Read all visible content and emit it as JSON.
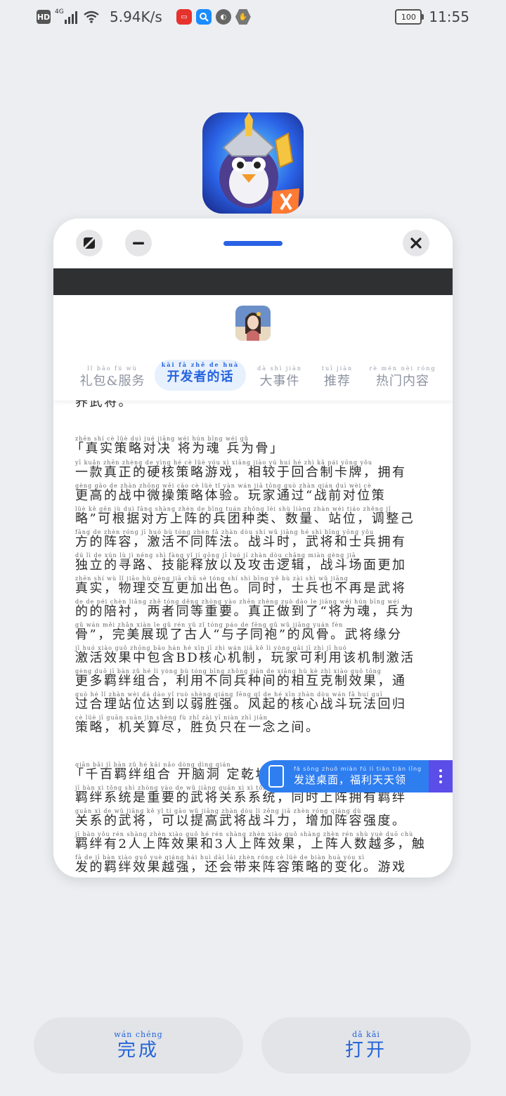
{
  "status_bar": {
    "network_badge": "HD",
    "network_type": "4G",
    "speed": "5.94K/s",
    "battery": "100",
    "time": "11:55",
    "app_icons": [
      "huawei-app-icon",
      "search-app-icon",
      "game-app-icon",
      "shield-app-icon"
    ]
  },
  "window": {
    "buttons": {
      "expand": "expand-icon",
      "minimize": "minimize-icon",
      "close": "close-icon"
    },
    "accent": "#2a62e6"
  },
  "tabs": [
    {
      "pinyin": "lǐ bāo    fú wù",
      "label": "礼包&服务"
    },
    {
      "pinyin": "kāi fā zhě de huà",
      "label": "开发者的话"
    },
    {
      "pinyin": "dà shì jiàn",
      "label": "大事件"
    },
    {
      "pinyin": "tuī jiàn",
      "label": "推荐"
    },
    {
      "pinyin": "rè mén nèi róng",
      "label": "热门内容"
    }
  ],
  "article": {
    "lines": [
      {
        "py": "",
        "text": "养武将。"
      },
      {
        "py": "zhēn  shí   cè   lüè   duì   jué       jiāng  wéi  hún     bīng  wéi   gǔ",
        "text": "「真实策略对决 将为魂 兵为骨」"
      },
      {
        "py": "yī  kuǎn zhēn zhèng de  yìng  hé   cè   lüè   yóu  xì     xiāng  jiào  yú   huí   hé   zhì   kǎ   pái      yōng  yǒu",
        "text": "一款真正的硬核策略游戏，相较于回合制卡牌，拥有"
      },
      {
        "py": "gèng  gāo  de  zhàn zhōng wēi  cāo   cè   lüè   tǐ   yàn      wán  jiā  tōng  guò    zhàn  qián  duì  wèi  cè",
        "text": "更高的战中微操策略体验。玩家通过“战前对位策"
      },
      {
        "py": "lüè      kě  gēn   jù   duì  fāng shàng zhèn de  bīng tuán zhǒng lèi     shù  liàng    zhàn  wèi     tiáo zhěng  jǐ",
        "text": "略”可根据对方上阵的兵团种类、数量、站位，调整己"
      },
      {
        "py": "fāng de zhèn róng    jī   huó   bù  tóng  zhèn  fǎ     zhàn dòu  shí     wǔ  jiāng  hé   shì  bīng yōng yǒu",
        "text": "方的阵容，激活不同阵法。战斗时，武将和士兵拥有"
      },
      {
        "py": "dú   lì   de  xún   lù     jì  néng  shì  fàng  yǐ   jí  gōng  jī   luó   jí     zhàn dòu chǎng miàn gèng  jiā",
        "text": "独立的寻路、技能释放以及攻击逻辑，战斗场面更加"
      },
      {
        "py": "zhēn  shí     wù   lǐ  jiāo  hù  gèng  jiā  chū  sè     tóng  shí     shì  bīng  yě   bù   zài  shì   wǔ  jiāng",
        "text": "真实，物理交互更加出色。同时，士兵也不再是武将"
      },
      {
        "py": "de  de  péi  chèn     liǎng  zhě tóng děng zhòng yào    zhēn zhèng  zuò  dào  le     jiāng wéi  hún      bīng  wéi",
        "text": "的的陪衬，两者同等重要。真正做到了“将为魂，兵为"
      },
      {
        "py": "gǔ      wán  měi  zhǎn xiàn  le   gǔ   rén     yǔ   zǐ  tóng  páo     de fēng  gǔ     wǔ  jiāng yuán  fèn",
        "text": "骨”，完美展现了古人“与子同袍”的风骨。武将缘分"
      },
      {
        "py": "jī   huó  xiào  guǒ zhōng bāo  hán                hé  xīn   jī   zhì     wán  jiā   kě   lì  yòng gāi  jī   zhì   jī   huó",
        "text": "激活效果中包含BD核心机制，玩家可利用该机制激活"
      },
      {
        "py": "gèng duō  jī   bàn  zǔ   hé     lì  yòng  bù  tóng bīng zhǒng jiān de  xiāng  hù   kè   zhì  xiào  guǒ     tōng",
        "text": "更多羁绊组合，利用不同兵种间的相互克制效果，通"
      },
      {
        "py": "guò  hé   lǐ  zhàn wèi  dá  dào  yǐ  ruò shèng qiáng    fēng  qǐ   de  hé  xīn  zhàn dòu  wán  fǎ   huí  guī",
        "text": "过合理站位达到以弱胜强。风起的核心战斗玩法回归"
      },
      {
        "py": "cè   lüè      jī  guān  suàn  jìn      shèng  fù   zhǐ  zài  yī  niàn  zhī  jiān",
        "text": "策略，机关算尽，胜负只在一念之间。"
      },
      {
        "py": "qiān  bǎi   jī   bàn  zǔ   hé      kāi  nǎo dòng  dìng  qián",
        "text": "「千百羁绊组合 开脑洞 定乾坤」"
      },
      {
        "py": "jī   bàn   xì  tǒng  shì zhòng yào  de  wǔ  jiāng guān  xì   xì  tǒng     tóng  shí shàng zhèn yōng  yǒu   jī   bàn",
        "text": "羁绊系统是重要的武将关系系统，同时上阵拥有羁绊"
      },
      {
        "py": "guān  xì   de  wǔ  jiāng     kě   yǐ   tí   gāo  wǔ  jiāng zhàn dòu  lì     zēng  jiā zhèn róng qiáng  dù",
        "text": "关系的武将，可以提高武将战斗力，增加阵容强度。"
      },
      {
        "py": "jī   bàn  yǒu      rén shàng zhèn xiào  guǒ  hé      rén shàng zhèn xiào  guǒ     shàng zhèn  rén  shù  yuè  duō     chù",
        "text": "羁绊有2人上阵效果和3人上阵效果，上阵人数越多，触"
      },
      {
        "py": "fā  de   jī   bàn  xiào  guǒ  yuè qiáng      hái  huì  dài  lái  zhèn róng  cè   lüè  de  biàn  huà     yóu  xì",
        "text": "发的羁绊效果越强，还会带来阵容策略的变化。游戏"
      }
    ]
  },
  "float_banner": {
    "pinyin": "fā  sòng zhuō miàn    fú   lì  tiān tiān lǐng",
    "label": "发送桌面，福利天天领"
  },
  "bottom": {
    "done": {
      "pinyin": "wán  chéng",
      "label": "完成"
    },
    "open": {
      "pinyin": "dǎ   kāi",
      "label": "打开"
    }
  }
}
